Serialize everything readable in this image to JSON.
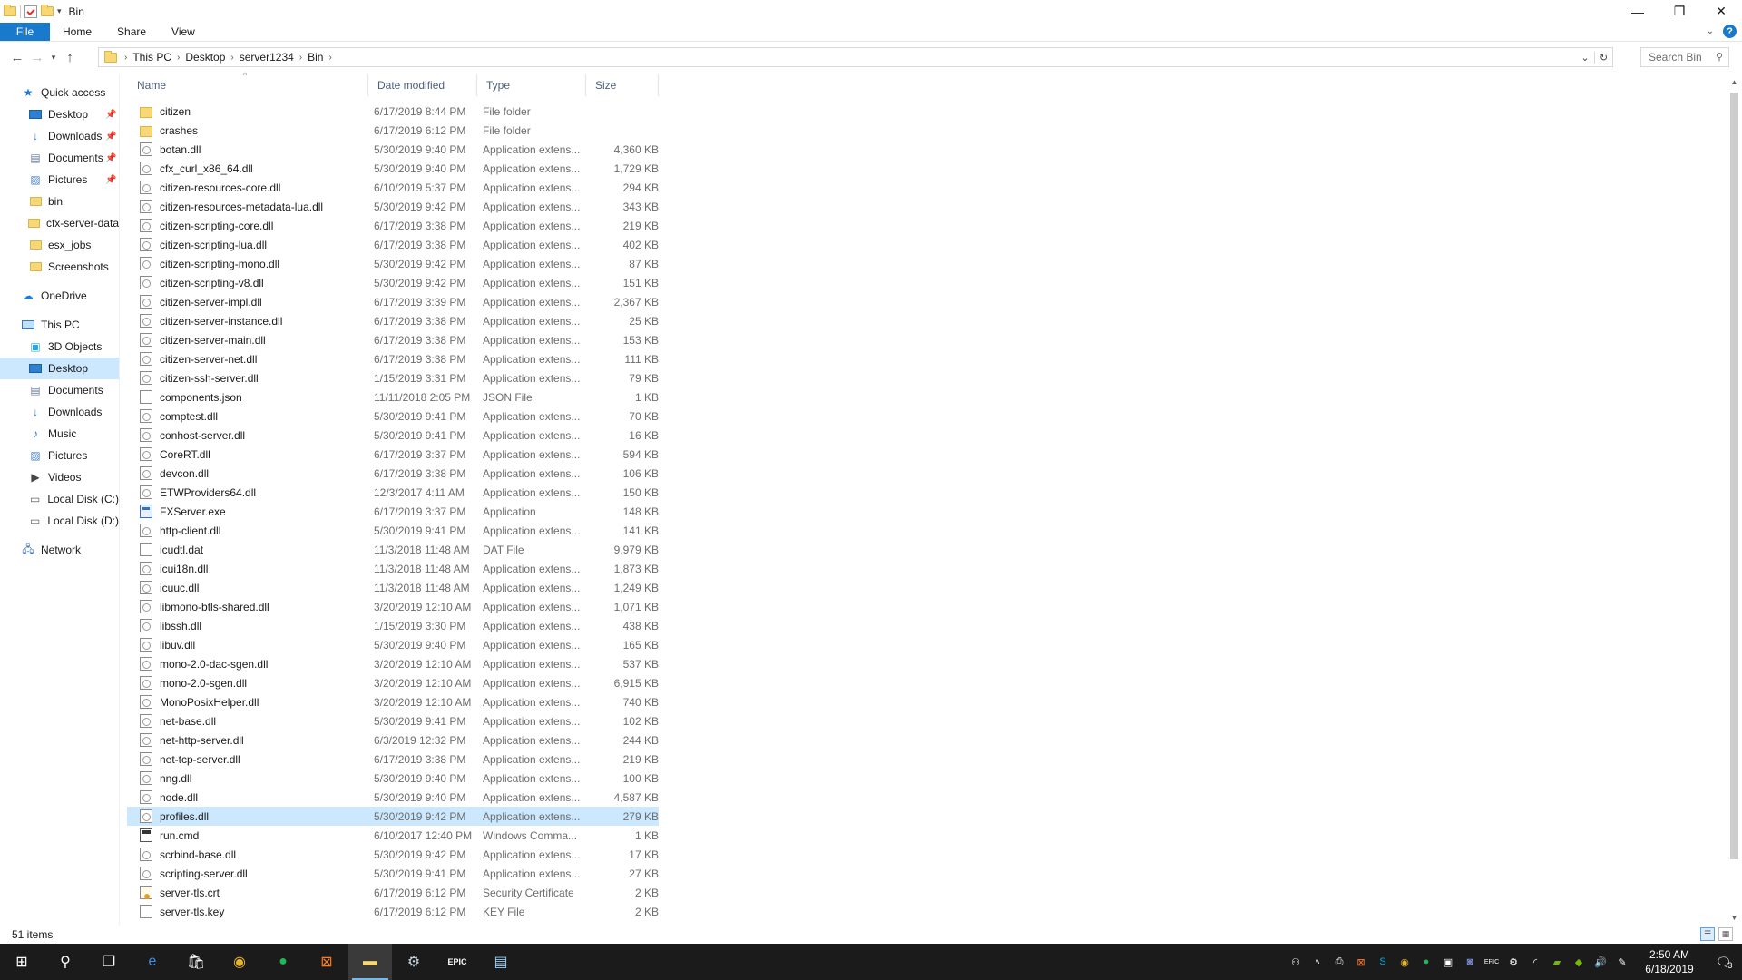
{
  "window": {
    "title": "Bin"
  },
  "ribbon": {
    "tabs": [
      "File",
      "Home",
      "Share",
      "View"
    ]
  },
  "address": {
    "crumbs": [
      "This PC",
      "Desktop",
      "server1234",
      "Bin"
    ]
  },
  "search": {
    "placeholder": "Search Bin"
  },
  "nav": {
    "quick_access": "Quick access",
    "quick_items": [
      {
        "label": "Desktop",
        "icon": "desktop-icon",
        "pinned": true
      },
      {
        "label": "Downloads",
        "icon": "download-icon",
        "pinned": true
      },
      {
        "label": "Documents",
        "icon": "documents-icon",
        "pinned": true
      },
      {
        "label": "Pictures",
        "icon": "pictures-icon",
        "pinned": true
      },
      {
        "label": "bin",
        "icon": "folder-icon",
        "pinned": false
      },
      {
        "label": "cfx-server-data",
        "icon": "folder-icon",
        "pinned": false
      },
      {
        "label": "esx_jobs",
        "icon": "folder-icon",
        "pinned": false
      },
      {
        "label": "Screenshots",
        "icon": "folder-icon",
        "pinned": false
      }
    ],
    "onedrive": "OneDrive",
    "this_pc": "This PC",
    "pc_items": [
      {
        "label": "3D Objects",
        "icon": "3d-objects-icon"
      },
      {
        "label": "Desktop",
        "icon": "desktop-icon",
        "selected": true
      },
      {
        "label": "Documents",
        "icon": "documents-icon"
      },
      {
        "label": "Downloads",
        "icon": "download-icon"
      },
      {
        "label": "Music",
        "icon": "music-icon"
      },
      {
        "label": "Pictures",
        "icon": "pictures-icon"
      },
      {
        "label": "Videos",
        "icon": "videos-icon"
      },
      {
        "label": "Local Disk (C:)",
        "icon": "drive-icon"
      },
      {
        "label": "Local Disk (D:)",
        "icon": "drive-icon"
      }
    ],
    "network": "Network"
  },
  "columns": {
    "name": "Name",
    "date": "Date modified",
    "type": "Type",
    "size": "Size"
  },
  "files": [
    {
      "name": "citizen",
      "date": "6/17/2019 8:44 PM",
      "type": "File folder",
      "size": "",
      "kind": "folder"
    },
    {
      "name": "crashes",
      "date": "6/17/2019 6:12 PM",
      "type": "File folder",
      "size": "",
      "kind": "folder"
    },
    {
      "name": "botan.dll",
      "date": "5/30/2019 9:40 PM",
      "type": "Application extens...",
      "size": "4,360 KB",
      "kind": "dll"
    },
    {
      "name": "cfx_curl_x86_64.dll",
      "date": "5/30/2019 9:40 PM",
      "type": "Application extens...",
      "size": "1,729 KB",
      "kind": "dll"
    },
    {
      "name": "citizen-resources-core.dll",
      "date": "6/10/2019 5:37 PM",
      "type": "Application extens...",
      "size": "294 KB",
      "kind": "dll"
    },
    {
      "name": "citizen-resources-metadata-lua.dll",
      "date": "5/30/2019 9:42 PM",
      "type": "Application extens...",
      "size": "343 KB",
      "kind": "dll"
    },
    {
      "name": "citizen-scripting-core.dll",
      "date": "6/17/2019 3:38 PM",
      "type": "Application extens...",
      "size": "219 KB",
      "kind": "dll"
    },
    {
      "name": "citizen-scripting-lua.dll",
      "date": "6/17/2019 3:38 PM",
      "type": "Application extens...",
      "size": "402 KB",
      "kind": "dll"
    },
    {
      "name": "citizen-scripting-mono.dll",
      "date": "5/30/2019 9:42 PM",
      "type": "Application extens...",
      "size": "87 KB",
      "kind": "dll"
    },
    {
      "name": "citizen-scripting-v8.dll",
      "date": "5/30/2019 9:42 PM",
      "type": "Application extens...",
      "size": "151 KB",
      "kind": "dll"
    },
    {
      "name": "citizen-server-impl.dll",
      "date": "6/17/2019 3:39 PM",
      "type": "Application extens...",
      "size": "2,367 KB",
      "kind": "dll"
    },
    {
      "name": "citizen-server-instance.dll",
      "date": "6/17/2019 3:38 PM",
      "type": "Application extens...",
      "size": "25 KB",
      "kind": "dll"
    },
    {
      "name": "citizen-server-main.dll",
      "date": "6/17/2019 3:38 PM",
      "type": "Application extens...",
      "size": "153 KB",
      "kind": "dll"
    },
    {
      "name": "citizen-server-net.dll",
      "date": "6/17/2019 3:38 PM",
      "type": "Application extens...",
      "size": "111 KB",
      "kind": "dll"
    },
    {
      "name": "citizen-ssh-server.dll",
      "date": "1/15/2019 3:31 PM",
      "type": "Application extens...",
      "size": "79 KB",
      "kind": "dll"
    },
    {
      "name": "components.json",
      "date": "11/11/2018 2:05 PM",
      "type": "JSON File",
      "size": "1 KB",
      "kind": "file"
    },
    {
      "name": "comptest.dll",
      "date": "5/30/2019 9:41 PM",
      "type": "Application extens...",
      "size": "70 KB",
      "kind": "dll"
    },
    {
      "name": "conhost-server.dll",
      "date": "5/30/2019 9:41 PM",
      "type": "Application extens...",
      "size": "16 KB",
      "kind": "dll"
    },
    {
      "name": "CoreRT.dll",
      "date": "6/17/2019 3:37 PM",
      "type": "Application extens...",
      "size": "594 KB",
      "kind": "dll"
    },
    {
      "name": "devcon.dll",
      "date": "6/17/2019 3:38 PM",
      "type": "Application extens...",
      "size": "106 KB",
      "kind": "dll"
    },
    {
      "name": "ETWProviders64.dll",
      "date": "12/3/2017 4:11 AM",
      "type": "Application extens...",
      "size": "150 KB",
      "kind": "dll"
    },
    {
      "name": "FXServer.exe",
      "date": "6/17/2019 3:37 PM",
      "type": "Application",
      "size": "148 KB",
      "kind": "exe"
    },
    {
      "name": "http-client.dll",
      "date": "5/30/2019 9:41 PM",
      "type": "Application extens...",
      "size": "141 KB",
      "kind": "dll"
    },
    {
      "name": "icudtl.dat",
      "date": "11/3/2018 11:48 AM",
      "type": "DAT File",
      "size": "9,979 KB",
      "kind": "file"
    },
    {
      "name": "icui18n.dll",
      "date": "11/3/2018 11:48 AM",
      "type": "Application extens...",
      "size": "1,873 KB",
      "kind": "dll"
    },
    {
      "name": "icuuc.dll",
      "date": "11/3/2018 11:48 AM",
      "type": "Application extens...",
      "size": "1,249 KB",
      "kind": "dll"
    },
    {
      "name": "libmono-btls-shared.dll",
      "date": "3/20/2019 12:10 AM",
      "type": "Application extens...",
      "size": "1,071 KB",
      "kind": "dll"
    },
    {
      "name": "libssh.dll",
      "date": "1/15/2019 3:30 PM",
      "type": "Application extens...",
      "size": "438 KB",
      "kind": "dll"
    },
    {
      "name": "libuv.dll",
      "date": "5/30/2019 9:40 PM",
      "type": "Application extens...",
      "size": "165 KB",
      "kind": "dll"
    },
    {
      "name": "mono-2.0-dac-sgen.dll",
      "date": "3/20/2019 12:10 AM",
      "type": "Application extens...",
      "size": "537 KB",
      "kind": "dll"
    },
    {
      "name": "mono-2.0-sgen.dll",
      "date": "3/20/2019 12:10 AM",
      "type": "Application extens...",
      "size": "6,915 KB",
      "kind": "dll"
    },
    {
      "name": "MonoPosixHelper.dll",
      "date": "3/20/2019 12:10 AM",
      "type": "Application extens...",
      "size": "740 KB",
      "kind": "dll"
    },
    {
      "name": "net-base.dll",
      "date": "5/30/2019 9:41 PM",
      "type": "Application extens...",
      "size": "102 KB",
      "kind": "dll"
    },
    {
      "name": "net-http-server.dll",
      "date": "6/3/2019 12:32 PM",
      "type": "Application extens...",
      "size": "244 KB",
      "kind": "dll"
    },
    {
      "name": "net-tcp-server.dll",
      "date": "6/17/2019 3:38 PM",
      "type": "Application extens...",
      "size": "219 KB",
      "kind": "dll"
    },
    {
      "name": "nng.dll",
      "date": "5/30/2019 9:40 PM",
      "type": "Application extens...",
      "size": "100 KB",
      "kind": "dll"
    },
    {
      "name": "node.dll",
      "date": "5/30/2019 9:40 PM",
      "type": "Application extens...",
      "size": "4,587 KB",
      "kind": "dll"
    },
    {
      "name": "profiles.dll",
      "date": "5/30/2019 9:42 PM",
      "type": "Application extens...",
      "size": "279 KB",
      "kind": "dll",
      "selected": true
    },
    {
      "name": "run.cmd",
      "date": "6/10/2017 12:40 PM",
      "type": "Windows Comma...",
      "size": "1 KB",
      "kind": "cmd"
    },
    {
      "name": "scrbind-base.dll",
      "date": "5/30/2019 9:42 PM",
      "type": "Application extens...",
      "size": "17 KB",
      "kind": "dll"
    },
    {
      "name": "scripting-server.dll",
      "date": "5/30/2019 9:41 PM",
      "type": "Application extens...",
      "size": "27 KB",
      "kind": "dll"
    },
    {
      "name": "server-tls.crt",
      "date": "6/17/2019 6:12 PM",
      "type": "Security Certificate",
      "size": "2 KB",
      "kind": "cert"
    },
    {
      "name": "server-tls.key",
      "date": "6/17/2019 6:12 PM",
      "type": "KEY File",
      "size": "2 KB",
      "kind": "file"
    }
  ],
  "status": {
    "items_count": "51 items"
  },
  "taskbar": {
    "apps": [
      {
        "name": "start-button",
        "icon": "windows-icon",
        "glyph": "⊞",
        "color": "#ffffff"
      },
      {
        "name": "search-button",
        "icon": "search-icon",
        "glyph": "⚲",
        "color": "#ffffff"
      },
      {
        "name": "task-view-button",
        "icon": "task-view-icon",
        "glyph": "❐",
        "color": "#ffffff"
      },
      {
        "name": "edge-app",
        "icon": "edge-icon",
        "glyph": "e",
        "color": "#3c8ee6"
      },
      {
        "name": "store-app",
        "icon": "store-icon",
        "glyph": "🛍",
        "color": "#ffffff"
      },
      {
        "name": "chrome-app",
        "icon": "chrome-icon",
        "glyph": "◉",
        "color": "#e8b52a"
      },
      {
        "name": "spotify-app",
        "icon": "spotify-icon",
        "glyph": "●",
        "color": "#1db954"
      },
      {
        "name": "xampp-app",
        "icon": "xampp-icon",
        "glyph": "⊠",
        "color": "#fb7a24"
      },
      {
        "name": "file-explorer-app",
        "icon": "folder-icon",
        "glyph": "▬",
        "color": "#f8d775",
        "active": true
      },
      {
        "name": "steam-app",
        "icon": "steam-icon",
        "glyph": "⚙",
        "color": "#c7d5e0"
      },
      {
        "name": "epic-games-app",
        "icon": "epic-games-icon",
        "glyph": "EPIC",
        "color": "#ffffff"
      },
      {
        "name": "notepad-app",
        "icon": "notepad-icon",
        "glyph": "▤",
        "color": "#9ad0f5"
      }
    ],
    "time": "2:50 AM",
    "date": "6/18/2019",
    "notifications": "3"
  }
}
